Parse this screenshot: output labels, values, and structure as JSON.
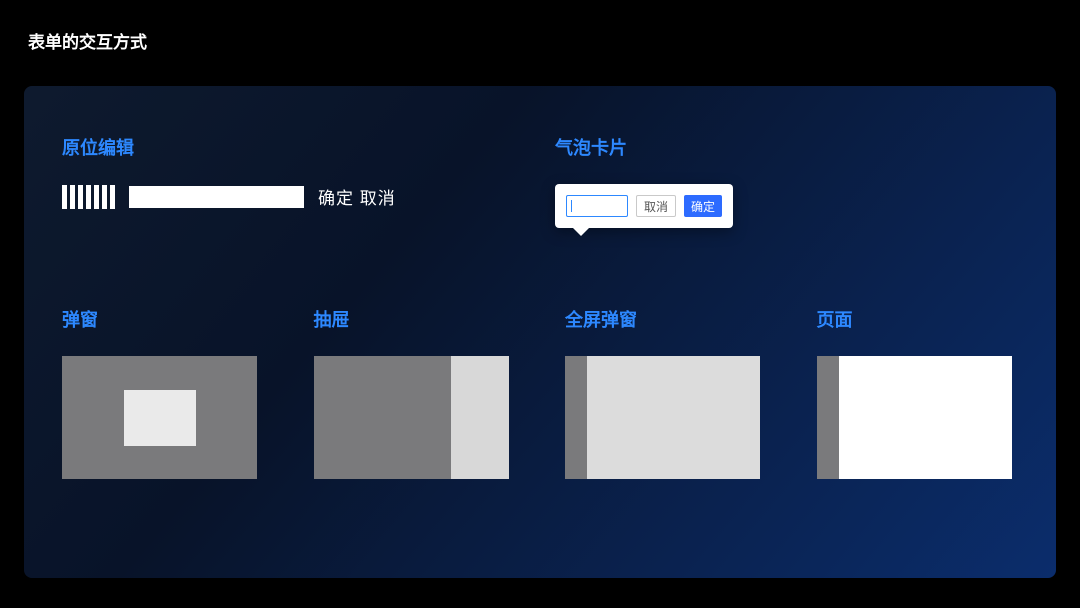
{
  "page": {
    "title": "表单的交互方式"
  },
  "top": {
    "inline_edit": {
      "title": "原位编辑",
      "confirm": "确定",
      "cancel": "取消"
    },
    "popover": {
      "title": "气泡卡片",
      "cancel": "取消",
      "confirm": "确定"
    }
  },
  "bottom": {
    "modal": {
      "title": "弹窗"
    },
    "drawer": {
      "title": "抽屉"
    },
    "fullscreen": {
      "title": "全屏弹窗"
    },
    "page": {
      "title": "页面"
    }
  }
}
